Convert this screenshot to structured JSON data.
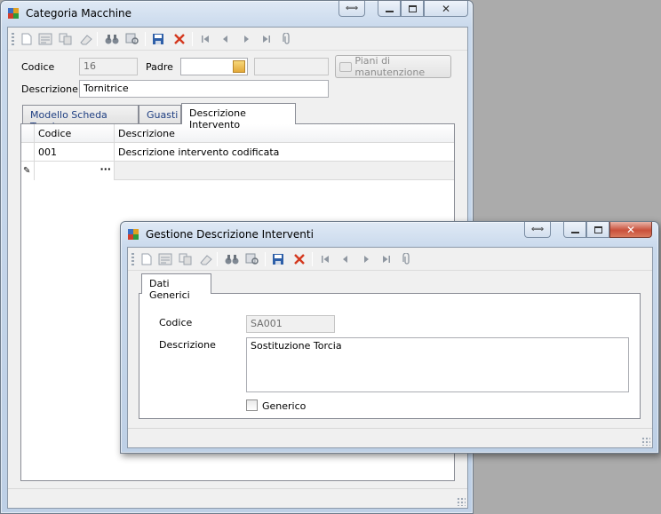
{
  "main_window": {
    "title": "Categoria Macchine",
    "codice_label": "Codice",
    "codice_value": "16",
    "padre_label": "Padre",
    "padre_value": "",
    "padre_desc_value": "",
    "piani_button": "Piani di manutenzione",
    "descrizione_label": "Descrizione",
    "descrizione_value": "Tornitrice",
    "tabs": [
      {
        "label": "Modello Scheda Tecnica"
      },
      {
        "label": "Guasti"
      },
      {
        "label": "Descrizione Intervento"
      }
    ],
    "grid": {
      "columns": [
        "Codice",
        "Descrizione"
      ],
      "rows": [
        {
          "codice": "001",
          "descrizione": "Descrizione intervento codificata"
        }
      ],
      "new_row_ellipsis": "···"
    }
  },
  "dialog": {
    "title": "Gestione Descrizione Interventi",
    "tab": "Dati Generici",
    "codice_label": "Codice",
    "codice_value": "SA001",
    "descrizione_label": "Descrizione",
    "descrizione_value": "Sostituzione Torcia",
    "generico_label": "Generico",
    "generico_checked": false
  },
  "colors": {
    "desktop": "#ababab",
    "save_icon": "#2e5fa8",
    "delete_icon": "#d4381e"
  }
}
